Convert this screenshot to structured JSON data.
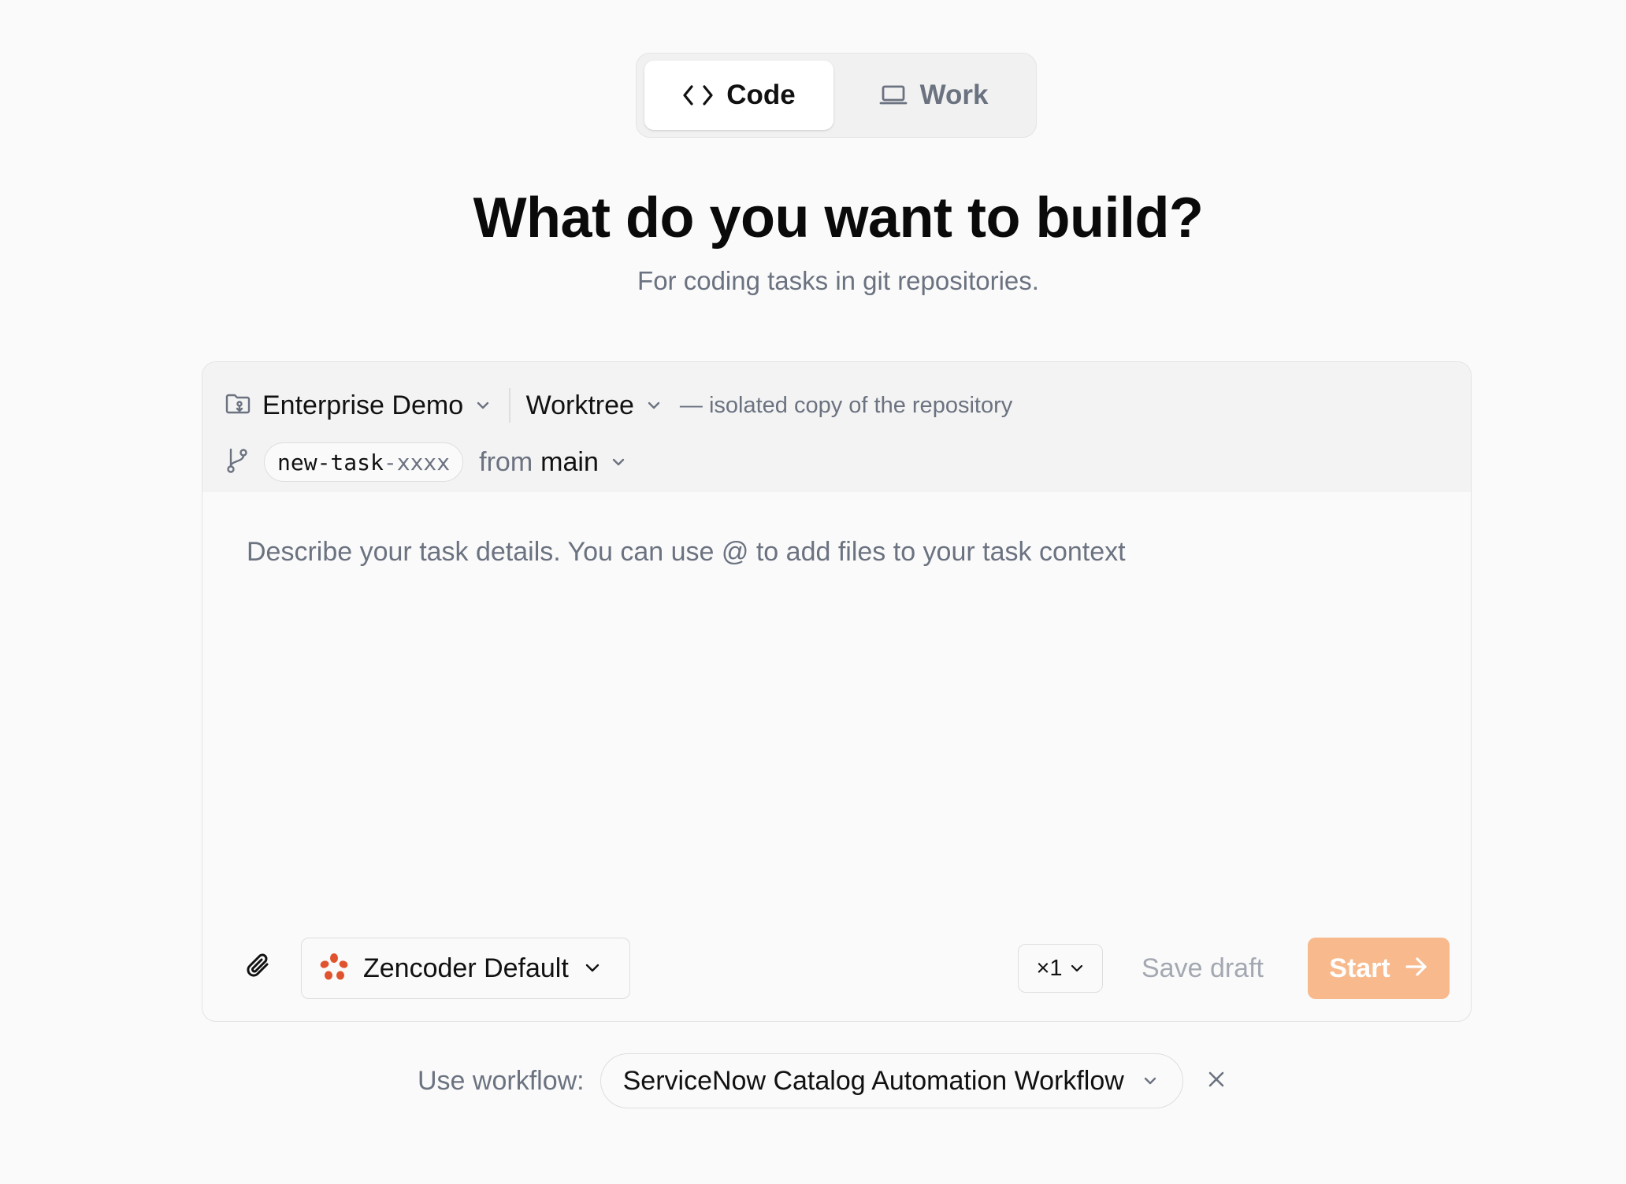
{
  "mode_tabs": [
    {
      "label": "Code",
      "icon": "code-brackets-icon",
      "active": true
    },
    {
      "label": "Work",
      "icon": "laptop-icon",
      "active": false
    }
  ],
  "heading": "What do you want to build?",
  "subheading": "For coding tasks in git repositories.",
  "composer": {
    "repo": {
      "label": "Enterprise Demo",
      "icon": "repo-folder-icon"
    },
    "mode": {
      "label": "Worktree",
      "description": "— isolated copy of the repository"
    },
    "branch": {
      "prefix": "new-task",
      "suffix": "-xxxx",
      "icon": "git-branch-icon"
    },
    "base": {
      "from_label": "from",
      "branch": "main"
    },
    "task_placeholder": "Describe your task details. You can use @ to add files to your task context",
    "task_value": "",
    "agent": {
      "label": "Zencoder Default",
      "icon": "zencoder-logo-icon"
    },
    "count": "×1",
    "save_draft_label": "Save draft",
    "start_label": "Start"
  },
  "workflow": {
    "label": "Use workflow:",
    "value": "ServiceNow Catalog Automation Workflow"
  },
  "colors": {
    "accent": "#f8b98c",
    "muted_text": "#6b7280",
    "logo_orange": "#e0532e",
    "background": "#fafafa"
  }
}
